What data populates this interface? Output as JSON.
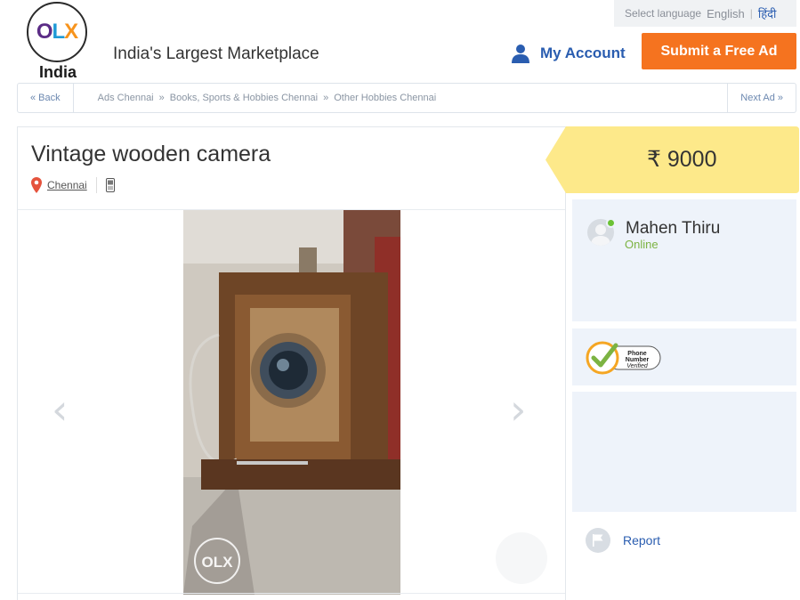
{
  "header": {
    "lang_label": "Select language",
    "lang_en": "English",
    "lang_separator": "|",
    "lang_hi": "हिंदी",
    "logo_text": "OLX",
    "logo_country": "India",
    "tagline": "India's Largest Marketplace",
    "account_label": "My Account",
    "submit_label": "Submit a Free Ad",
    "accent_color": "#f5731f",
    "link_color": "#2a5db0"
  },
  "breadcrumb": {
    "back": "« Back",
    "items": [
      "Ads Chennai",
      "Books, Sports & Hobbies Chennai",
      "Other Hobbies Chennai"
    ],
    "separator": "»",
    "next": "Next Ad »"
  },
  "ad": {
    "title": "Vintage wooden camera",
    "location": "Chennai",
    "price": "₹ 9000",
    "price_bg": "#fde98a",
    "watermark": "OLX",
    "image_icon": "photo-vintage-camera",
    "prev_icon": "chevron-left-icon",
    "next_icon": "chevron-right-icon"
  },
  "seller": {
    "name": "Mahen Thiru",
    "status": "Online",
    "status_color": "#7cb342",
    "badge_line1": "Phone",
    "badge_line2": "Number",
    "badge_line3": "Verified"
  },
  "report": {
    "label": "Report"
  }
}
